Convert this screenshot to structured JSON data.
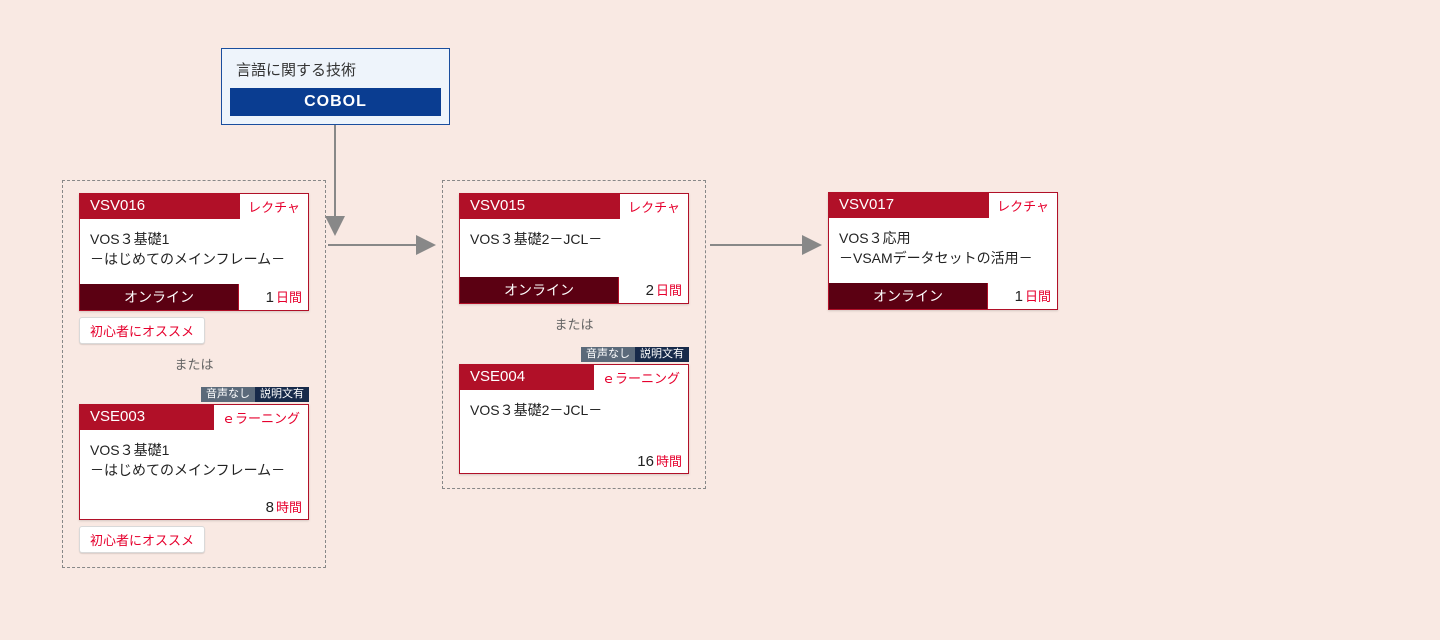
{
  "langBox": {
    "title": "言語に関する技術",
    "bar": "COBOL"
  },
  "group1": {
    "or": "または",
    "card1": {
      "code": "VSV016",
      "type": "レクチャ",
      "title": "VOS３基礎1\n－はじめてのメインフレーム－",
      "mode": "オンライン",
      "dur_num": "1",
      "dur_unit": "日間",
      "rec": "初心者にオススメ"
    },
    "card2": {
      "audio1": "音声なし",
      "audio2": "説明文有",
      "code": "VSE003",
      "type": "ｅラーニング",
      "title": "VOS３基礎1\n－はじめてのメインフレーム－",
      "dur_num": "8",
      "dur_unit": "時間",
      "rec": "初心者にオススメ"
    }
  },
  "group2": {
    "or": "または",
    "card1": {
      "code": "VSV015",
      "type": "レクチャ",
      "title": "VOS３基礎2－JCL－",
      "mode": "オンライン",
      "dur_num": "2",
      "dur_unit": "日間"
    },
    "card2": {
      "audio1": "音声なし",
      "audio2": "説明文有",
      "code": "VSE004",
      "type": "ｅラーニング",
      "title": "VOS３基礎2－JCL－",
      "dur_num": "16",
      "dur_unit": "時間"
    }
  },
  "card3": {
    "code": "VSV017",
    "type": "レクチャ",
    "title": "VOS３応用\n－VSAMデータセットの活用－",
    "mode": "オンライン",
    "dur_num": "1",
    "dur_unit": "日間"
  }
}
